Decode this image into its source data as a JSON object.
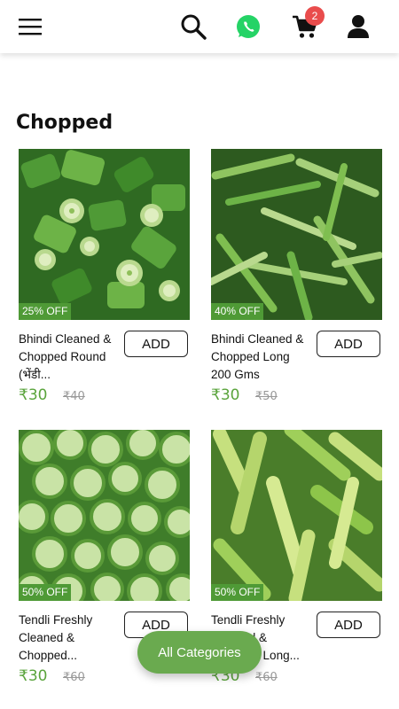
{
  "colors": {
    "accent": "#5aa43c",
    "whatsapp": "#25d366",
    "badge": "#e94c4c",
    "discount_bg": "#4f9a36",
    "fab": "#6aaa4f"
  },
  "header": {
    "icons": [
      "menu-icon",
      "search-icon",
      "whatsapp-icon",
      "cart-icon",
      "user-icon"
    ],
    "cart_count": "2"
  },
  "section": {
    "title": "Chopped"
  },
  "products": [
    {
      "image": "okra-chopped-round",
      "discount": "25% OFF",
      "name": "Bhindi Cleaned & Chopped Round (भेंडी...",
      "add_label": "ADD",
      "price": "₹30",
      "mrp": "₹40"
    },
    {
      "image": "okra-chopped-long",
      "discount": "40% OFF",
      "name": "Bhindi Cleaned & Chopped Long 200 Gms",
      "add_label": "ADD",
      "price": "₹30",
      "mrp": "₹50"
    },
    {
      "image": "tendli-chopped-round",
      "discount": "50% OFF",
      "name": "Tendli Freshly Cleaned & Chopped...",
      "add_label": "ADD",
      "price": "₹30",
      "mrp": "₹60"
    },
    {
      "image": "tendli-chopped-long",
      "discount": "50% OFF",
      "name": "Tendli Freshly Cleaned & Chopped Long...",
      "add_label": "ADD",
      "price": "₹30",
      "mrp": "₹60"
    }
  ],
  "fab": {
    "label": "All Categories"
  }
}
